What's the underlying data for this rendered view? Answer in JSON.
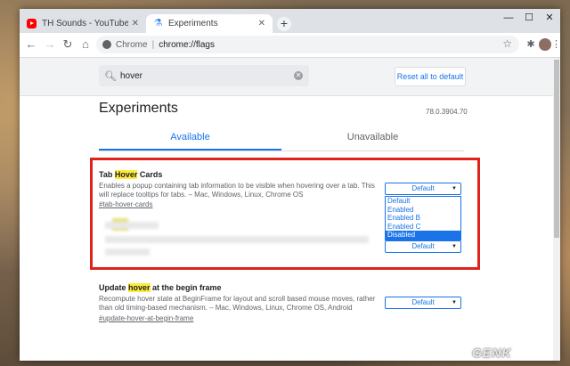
{
  "tabs": [
    {
      "title": "TH Sounds - YouTube",
      "icon": "youtube-icon"
    },
    {
      "title": "Experiments",
      "icon": "flask-icon"
    }
  ],
  "window_controls": {
    "minimize": "—",
    "maximize": "☐",
    "close": "✕"
  },
  "toolbar": {
    "url_origin": "Chrome",
    "url_separator": "|",
    "url_path": "chrome://flags"
  },
  "flags": {
    "search_value": "hover",
    "reset_label": "Reset all to default",
    "title": "Experiments",
    "version": "78.0.3904.70",
    "tab_available": "Available",
    "tab_unavailable": "Unavailable",
    "experiments": [
      {
        "name_before": "Tab ",
        "name_highlight": "Hover",
        "name_after": " Cards",
        "description": "Enables a popup containing tab information to be visible when hovering over a tab. This will replace tooltips for tabs. – Mac, Windows, Linux, Chrome OS",
        "link": "#tab-hover-cards",
        "select_value": "Default",
        "options": [
          "Default",
          "Enabled",
          "Enabled B",
          "Enabled C",
          "Disabled"
        ],
        "highlighted_option": "Disabled"
      },
      {
        "select_value": "Default"
      },
      {
        "name_before": "Update ",
        "name_highlight": "hover",
        "name_after": " at the begin frame",
        "description": "Recompute hover state at BeginFrame for layout and scroll based mouse moves, rather than old timing-based mechanism. – Mac, Windows, Linux, Chrome OS, Android",
        "link": "#update-hover-at-begin-frame",
        "select_value": "Default"
      }
    ]
  },
  "watermark": "GENK",
  "colors": {
    "accent": "#1a73e8",
    "highlight_box": "#e0221b",
    "search_highlight": "#ffeb3b"
  }
}
